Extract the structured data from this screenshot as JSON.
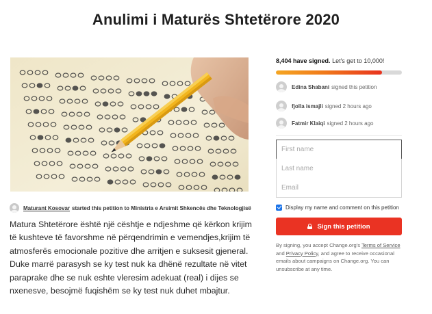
{
  "page": {
    "title": "Anulimi i Maturës Shtetërore 2020"
  },
  "byline": {
    "author": "Maturant Kosovar",
    "rest": "started this petition to Ministria e Arsimit Shkencës dhe Teknologjisë"
  },
  "body": {
    "text": "Matura Shtetërore është një cështje e ndjeshme që kërkon krijim të kushteve të favorshme në përqendrimin e vemendjes,krijim të atmosferës emocionale pozitive dhe arritjen e suksesit gjeneral. Duke marrë parasysh se ky test nuk ka dhënë rezultate në vitet paraprake dhe se nuk eshte vleresim adekuat (real) i dijes se nxenesve, besojmë fuqishëm se ky test nuk duhet mbajtur."
  },
  "progress": {
    "count_label": "8,404 have signed.",
    "goal_label": "Let's get to 10,000!",
    "fraction": 0.8404,
    "gradient_colors": [
      "#f5a623",
      "#e8331f"
    ]
  },
  "signers": [
    {
      "name": "Edina Shabani",
      "action": "signed this petition"
    },
    {
      "name": "fjolla ismajli",
      "action": "signed 2 hours ago"
    },
    {
      "name": "Fatmir Klaiqi",
      "action": "signed 2 hours ago"
    }
  ],
  "form": {
    "first_name_placeholder": "First name",
    "last_name_placeholder": "Last name",
    "email_placeholder": "Email",
    "display_checkbox_label": "Display my name and comment on this petition",
    "display_checked": true,
    "sign_button_label": "Sign this petition",
    "sign_button_icon": "lock-icon",
    "sign_button_color": "#ea3323"
  },
  "legal": {
    "prefix": "By signing, you accept Change.org's",
    "terms_link": "Terms of Service",
    "and": "and",
    "privacy_link": "Privacy Policy",
    "suffix": ", and agree to receive occasional emails about campaigns on Change.org. You can unsubscribe at any time."
  }
}
